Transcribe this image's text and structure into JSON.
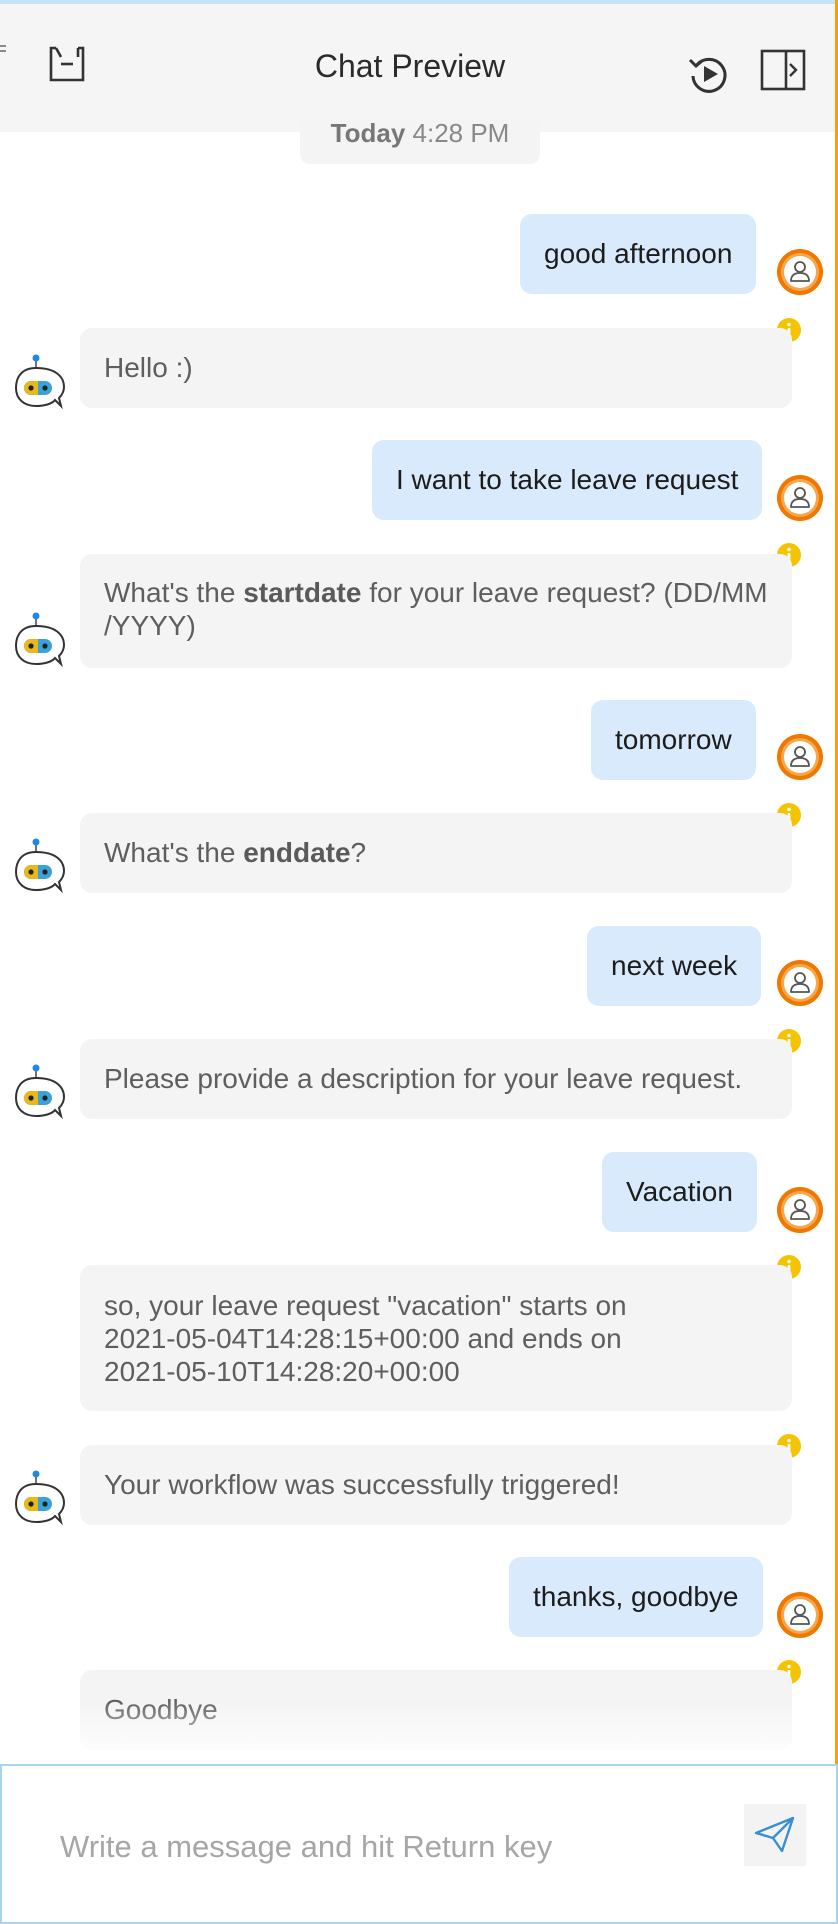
{
  "header": {
    "title": "Chat Preview",
    "icons": [
      "clipboard-icon",
      "replay-icon",
      "collapse-panel-icon"
    ]
  },
  "date_separator": {
    "day": "Today",
    "time": "4:28 PM"
  },
  "messages": [
    {
      "from": "user",
      "text": "good afternoon"
    },
    {
      "from": "bot",
      "text": "Hello :)"
    },
    {
      "from": "user",
      "text": "I want to take leave request"
    },
    {
      "from": "bot",
      "before": "What's the ",
      "bold": "startdate",
      "after": " for your leave request? (DD/MM\n/YYYY)"
    },
    {
      "from": "user",
      "text": "tomorrow"
    },
    {
      "from": "bot",
      "before": "What's the ",
      "bold": "enddate",
      "after": "?"
    },
    {
      "from": "user",
      "text": "next week"
    },
    {
      "from": "bot",
      "text": "Please provide a description for your leave request."
    },
    {
      "from": "user",
      "text": "Vacation"
    },
    {
      "from": "bot",
      "line1": "so, your leave request \"vacation\" starts on",
      "line2": "2021-05-04T14:28:15+00:00 and ends on",
      "line3": "2021-05-10T14:28:20+00:00"
    },
    {
      "from": "bot",
      "text": "Your workflow was successfully triggered!"
    },
    {
      "from": "user",
      "text": "thanks, goodbye"
    },
    {
      "from": "bot",
      "text": "Goodbye"
    }
  ],
  "composer": {
    "placeholder": "Write a message and hit Return key",
    "value": "",
    "send_icon": "send-icon"
  },
  "colors": {
    "user_bubble": "#d8eafc",
    "bot_bubble": "#f4f4f4",
    "avatar_ring": "#f07800",
    "info_badge": "#f5c400",
    "accent_blue": "#3a8fd0"
  }
}
